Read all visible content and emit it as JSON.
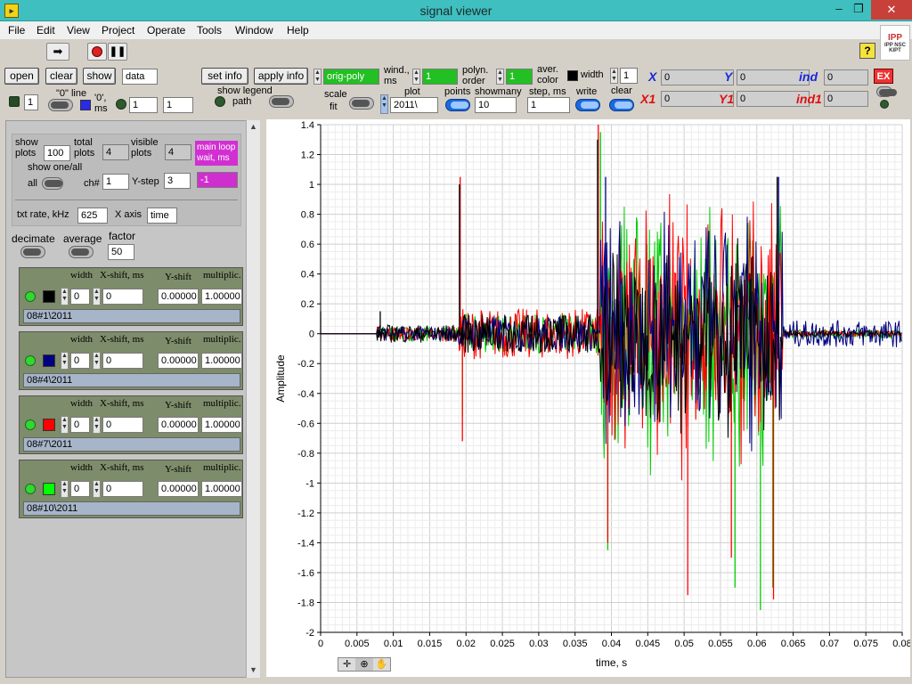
{
  "window": {
    "title": "signal viewer"
  },
  "menu": [
    "File",
    "Edit",
    "View",
    "Project",
    "Operate",
    "Tools",
    "Window",
    "Help"
  ],
  "logo_text": "IPP NSC KIPT",
  "controls": {
    "open_label": "open",
    "clear_label": "clear",
    "show_label": "show",
    "data_value": "data",
    "set_info_label": "set info",
    "apply_info_label": "apply info",
    "filter_value": "orig-poly",
    "wind_label": "wind., ms",
    "wind_value": "1",
    "polyn_label": "polyn. order",
    "polyn_value": "1",
    "aver_color_label": "aver. color",
    "width_label": "width",
    "width_value": "1",
    "ch_count_value": "1",
    "zero_line_label": "\"0\" line",
    "zero_ms_label": "'0', ms",
    "zero_ms_a": "1",
    "zero_ms_b": "1",
    "show_legend_label": "show legend",
    "path_label": "path",
    "scale_fit_label_a": "scale",
    "scale_fit_label_b": "fit",
    "plot_label": "plot",
    "plot_value": "2011\\",
    "points_label": "points",
    "showmany_label": "showmany",
    "showmany_value": "10",
    "step_label": "step, ms",
    "step_value": "1",
    "write_label": "write",
    "clear2_label": "clear",
    "x_label": "X",
    "x_value": "0",
    "y_label": "Y",
    "y_value": "0",
    "ind_label": "ind",
    "ind_value": "0",
    "x1_label": "X1",
    "x1_value": "0",
    "y1_label": "Y1",
    "y1_value": "0",
    "ind1_label": "ind1",
    "ind1_value": "0",
    "ex_label": "EX"
  },
  "left": {
    "show_plots_label": "show plots",
    "show_plots_value": "100",
    "total_plots_label": "total plots",
    "total_plots_value": "4",
    "visible_plots_label": "visible plots",
    "visible_plots_value": "4",
    "main_loop_label": "main loop wait, ms",
    "main_loop_value": "-1",
    "show_one_all_label": "show one/all",
    "all_label": "all",
    "ch_label": "ch#",
    "ch_value": "1",
    "ystep_label": "Y-step",
    "ystep_value": "3",
    "txt_rate_label": "txt rate, kHz",
    "txt_rate_value": "625",
    "x_axis_label": "X axis",
    "x_axis_value": "time",
    "decimate_label": "decimate",
    "average_label": "average",
    "factor_label": "factor",
    "factor_value": "50",
    "ch_hdr": {
      "width": "width",
      "xshift": "X-shift, ms",
      "yshift": "Y-shift",
      "mult": "multiplic."
    },
    "channels": [
      {
        "color": "#000000",
        "width": "0",
        "xshift": "0",
        "yshift": "0.00000",
        "mult": "1.00000",
        "name": "08#1\\2011"
      },
      {
        "color": "#000080",
        "width": "0",
        "xshift": "0",
        "yshift": "0.00000",
        "mult": "1.00000",
        "name": "08#4\\2011"
      },
      {
        "color": "#ff0000",
        "width": "0",
        "xshift": "0",
        "yshift": "0.00000",
        "mult": "1.00000",
        "name": "08#7\\2011"
      },
      {
        "color": "#00ff00",
        "width": "0",
        "xshift": "0",
        "yshift": "0.00000",
        "mult": "1.00000",
        "name": "08#10\\2011"
      }
    ]
  },
  "chart_data": {
    "type": "line",
    "title": "",
    "xlabel": "time, s",
    "ylabel": "Amplitude",
    "xlim": [
      0,
      0.08
    ],
    "ylim": [
      -2,
      1.4
    ],
    "x_ticks": [
      "0",
      "0.005",
      "0.01",
      "0.015",
      "0.02",
      "0.025",
      "0.03",
      "0.035",
      "0.04",
      "0.045",
      "0.05",
      "0.055",
      "0.06",
      "0.065",
      "0.07",
      "0.075",
      "0.08"
    ],
    "y_ticks": [
      "1.4",
      "1.2",
      "1",
      "0.8",
      "0.6",
      "0.4",
      "0.2",
      "0",
      "-0.2",
      "-0.4",
      "-0.6",
      "-0.8",
      "-1",
      "-1.2",
      "-1.4",
      "-1.6",
      "-1.8",
      "-2"
    ],
    "grid": true,
    "series": [
      {
        "color": "#00cc00",
        "segments": [
          [
            0,
            0.08,
            0
          ],
          [
            0.0078,
            0.019,
            0.05
          ],
          [
            0.019,
            0.0385,
            0.13
          ],
          [
            0.0385,
            0.0635,
            0.75
          ],
          [
            0.0635,
            0.08,
            0.03
          ]
        ],
        "peaks": [
          [
            0.0195,
            -0.55
          ],
          [
            0.0385,
            1.35
          ],
          [
            0.0395,
            -1.45
          ],
          [
            0.057,
            -1.7
          ],
          [
            0.0605,
            -1.85
          ],
          [
            0.0622,
            -1.7
          ]
        ]
      },
      {
        "color": "#ff0000",
        "segments": [
          [
            0,
            0.08,
            0
          ],
          [
            0.0078,
            0.019,
            0.05
          ],
          [
            0.019,
            0.0385,
            0.17
          ],
          [
            0.0385,
            0.0635,
            0.78
          ],
          [
            0.0635,
            0.08,
            0.02
          ]
        ],
        "peaks": [
          [
            0.0192,
            1.05
          ],
          [
            0.0195,
            -0.72
          ],
          [
            0.0382,
            1.4
          ],
          [
            0.0395,
            -1.4
          ],
          [
            0.0505,
            -1.75
          ],
          [
            0.0565,
            -1.5
          ],
          [
            0.0623,
            -1.78
          ]
        ]
      },
      {
        "color": "#000080",
        "segments": [
          [
            0,
            0.08,
            0
          ],
          [
            0.0078,
            0.019,
            0.05
          ],
          [
            0.019,
            0.0385,
            0.12
          ],
          [
            0.0385,
            0.0635,
            0.7
          ],
          [
            0.0635,
            0.08,
            0.09
          ]
        ],
        "peaks": [
          [
            0.0392,
            1.05
          ],
          [
            0.063,
            1.05
          ]
        ]
      },
      {
        "color": "#000000",
        "segments": [
          [
            0,
            0.08,
            0
          ],
          [
            0.0078,
            0.019,
            0.06
          ],
          [
            0.019,
            0.0385,
            0.13
          ],
          [
            0.0385,
            0.0635,
            0.55
          ],
          [
            0.0635,
            0.08,
            0.02
          ]
        ],
        "peaks": [
          [
            0.0,
            0.15
          ],
          [
            0.0191,
            1.0
          ],
          [
            0.0381,
            1.3
          ],
          [
            0.0628,
            1.05
          ],
          [
            0.0082,
            0.15
          ]
        ]
      }
    ]
  }
}
